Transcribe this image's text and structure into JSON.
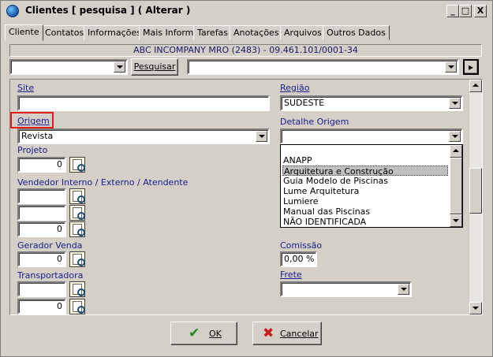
{
  "window": {
    "title": "Clientes [ pesquisa ] ( Alterar )"
  },
  "titlebar_buttons": [
    "_",
    "□",
    "X"
  ],
  "tabs": [
    {
      "label": "Cliente",
      "active": true
    },
    {
      "label": "Contatos"
    },
    {
      "label": "Informações"
    },
    {
      "label": "Mais Inform."
    },
    {
      "label": "Tarefas"
    },
    {
      "label": "Anotações"
    },
    {
      "label": "Arquivos"
    },
    {
      "label": "Outros Dados"
    }
  ],
  "infobar": "ABC INCOMPANY MRO  (2483) - 09.461.101/0001-34",
  "search": {
    "type_value": "",
    "button_label": "Pesquisar",
    "term_value": "",
    "nav_label": "▸"
  },
  "form": {
    "site": {
      "label": "Site",
      "value": ""
    },
    "regiao": {
      "label": "Região",
      "value": "SUDESTE"
    },
    "origem": {
      "label": "Origem",
      "value": "Revista"
    },
    "detalhe_origem": {
      "label": "Detalhe Origem",
      "value": "",
      "options": [
        "ANAPP",
        "Arquitetura e Construção",
        "Guia Modelo de Piscinas",
        "Lume Arquitetura",
        "Lumiere",
        "Manual das Piscinas",
        "NÃO IDENTIFICADA"
      ],
      "selected_index": 1
    },
    "projeto": {
      "label": "Projeto",
      "value": "0"
    },
    "vendedor": {
      "label": "Vendedor Interno / Externo / Atendente",
      "values": [
        "",
        "",
        "0"
      ]
    },
    "gerador_venda": {
      "label": "Gerador Venda",
      "value": "0"
    },
    "comissao": {
      "label": "Comissão",
      "value": "0,00 %"
    },
    "transportadora": {
      "label": "Transportadora",
      "values": [
        "",
        "0"
      ]
    },
    "frete": {
      "label": "Frete",
      "value": ""
    }
  },
  "buttons": {
    "ok": {
      "label": "OK",
      "color": "#1f8a1f"
    },
    "cancel": {
      "label": "Cancelar",
      "color": "#c81e1e"
    }
  },
  "colors": {
    "highlight": "#e31c1c",
    "label_blue": "#1a1a8c"
  }
}
